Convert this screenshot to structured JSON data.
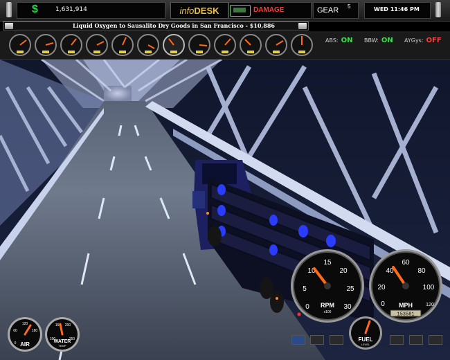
{
  "header": {
    "cash_symbol": "$",
    "cash": "1,631,914",
    "infodesk_prefix": "info",
    "infodesk_suffix": "DESK",
    "damage_label": "DAMAGE",
    "gear_label": "GEAR",
    "gear_value": "5",
    "datetime": "WED 11:46 PM"
  },
  "job": {
    "description": "Liquid Oxygen to Sausalito Dry Goods in  San Francisco - $10,886"
  },
  "status_indicators": [
    {
      "label": "ABS:",
      "value": "ON",
      "color": "#35e04a"
    },
    {
      "label": "BBW:",
      "value": "ON",
      "color": "#35e04a"
    },
    {
      "label": "AYGys:",
      "value": "OFF",
      "color": "#ff3a3a"
    }
  ],
  "gauges": {
    "rpm": {
      "label": "RPM",
      "sub": "x100",
      "ticks": [
        "0",
        "5",
        "10",
        "15",
        "20",
        "25",
        "30"
      ]
    },
    "mph": {
      "label": "MPH",
      "ticks": [
        "0",
        "20",
        "40",
        "60",
        "80",
        "100",
        "120"
      ],
      "odometer": "153581"
    },
    "fuel": {
      "label": "FUEL",
      "sub": "LEVEL"
    },
    "air": {
      "label": "AIR",
      "ticks": [
        "0",
        "60",
        "120",
        "180"
      ]
    },
    "water": {
      "label": "WATER",
      "sub": "TEMP",
      "ticks": [
        "100",
        "150",
        "200",
        "250"
      ]
    }
  },
  "colors": {
    "cash_icon": "#2bd14a",
    "infodesk": "#f0c23a",
    "damage": "#ff3a3a",
    "needle": "#ff6a1a",
    "on": "#35e04a",
    "off": "#ff3a3a"
  }
}
